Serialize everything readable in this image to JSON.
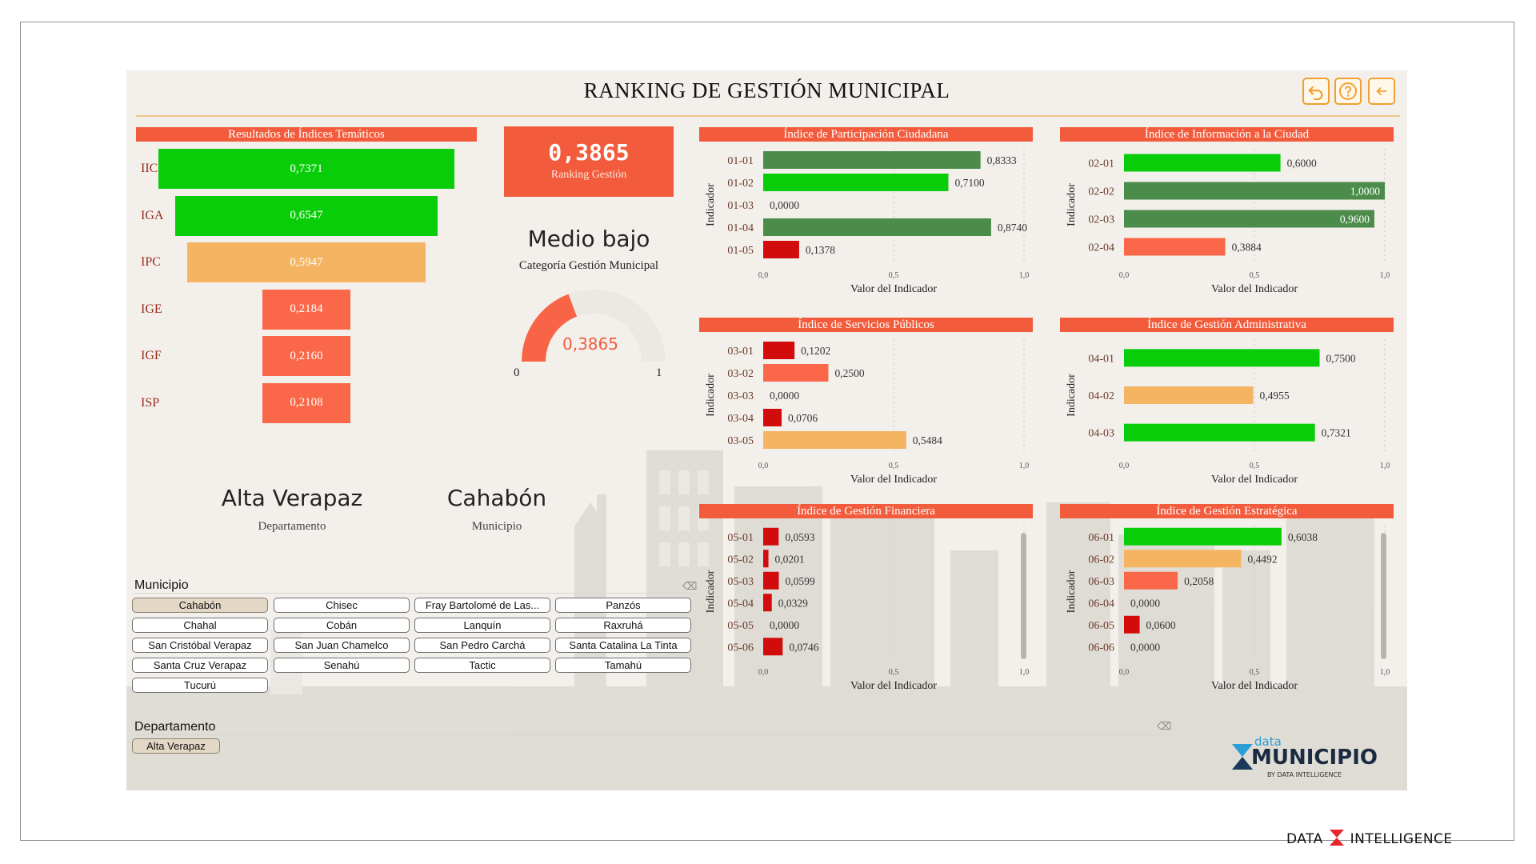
{
  "title": "RANKING DE GESTIÓN MUNICIPAL",
  "toolbar": {
    "reset_icon": "undo-icon",
    "help_icon": "help-icon",
    "back_icon": "back-arrow-icon"
  },
  "colors": {
    "dark_green": "#4c8c4a",
    "green": "#0acd0a",
    "amber": "#f4b462",
    "orange": "#fb6849",
    "red": "#d20c0c",
    "header": "#f25c3c"
  },
  "funnel": {
    "header": "Resultados de Índices Temáticos",
    "items": [
      {
        "label": "IIC",
        "value": 0.7371,
        "text": "0,7371",
        "color": "#0acd0a"
      },
      {
        "label": "IGA",
        "value": 0.6547,
        "text": "0,6547",
        "color": "#0acd0a"
      },
      {
        "label": "IPC",
        "value": 0.5947,
        "text": "0,5947",
        "color": "#f4b462"
      },
      {
        "label": "IGE",
        "value": 0.2184,
        "text": "0,2184",
        "color": "#fb6849"
      },
      {
        "label": "IGF",
        "value": 0.216,
        "text": "0,2160",
        "color": "#fb6849"
      },
      {
        "label": "ISP",
        "value": 0.2108,
        "text": "0,2108",
        "color": "#fb6849"
      }
    ]
  },
  "kpi": {
    "value": "0,3865",
    "label": "Ranking Gestión"
  },
  "category": {
    "title": "Medio bajo",
    "subtitle": "Categoría Gestión Municipal"
  },
  "gauge": {
    "value": 0.3865,
    "value_text": "0,3865",
    "min": "0",
    "max": "1"
  },
  "location": {
    "department": "Alta Verapaz",
    "department_label": "Departamento",
    "municipality": "Cahabón",
    "municipality_label": "Municipio"
  },
  "chart_data": [
    {
      "type": "bar",
      "title": "Índice de Participación Ciudadana",
      "xlabel": "Valor del Indicador",
      "ylabel": "Indicador",
      "xlim": [
        0,
        1
      ],
      "xticks": [
        "0,0",
        "0,5",
        "1,0"
      ],
      "categories": [
        "01-01",
        "01-02",
        "01-03",
        "01-04",
        "01-05"
      ],
      "values": [
        0.8333,
        0.71,
        0.0,
        0.874,
        0.1378
      ],
      "labels": [
        "0,8333",
        "0,7100",
        "0,0000",
        "0,8740",
        "0,1378"
      ],
      "colors": [
        "#4c8c4a",
        "#0acd0a",
        "#0acd0a",
        "#4c8c4a",
        "#d20c0c"
      ]
    },
    {
      "type": "bar",
      "title": "Índice de Información a la Ciudad",
      "xlabel": "Valor del Indicador",
      "ylabel": "Indicador",
      "xlim": [
        0,
        1
      ],
      "xticks": [
        "0,0",
        "0,5",
        "1,0"
      ],
      "categories": [
        "02-01",
        "02-02",
        "02-03",
        "02-04"
      ],
      "values": [
        0.6,
        1.0,
        0.96,
        0.3884
      ],
      "labels": [
        "0,6000",
        "1,0000",
        "0,9600",
        "0,3884"
      ],
      "colors": [
        "#0acd0a",
        "#4c8c4a",
        "#4c8c4a",
        "#fb6849"
      ]
    },
    {
      "type": "bar",
      "title": "Índice de Servicios Públicos",
      "xlabel": "Valor del Indicador",
      "ylabel": "Indicador",
      "xlim": [
        0,
        1
      ],
      "xticks": [
        "0,0",
        "0,5",
        "1,0"
      ],
      "categories": [
        "03-01",
        "03-02",
        "03-03",
        "03-04",
        "03-05"
      ],
      "values": [
        0.1202,
        0.25,
        0.0,
        0.0706,
        0.5484
      ],
      "labels": [
        "0,1202",
        "0,2500",
        "0,0000",
        "0,0706",
        "0,5484"
      ],
      "colors": [
        "#d20c0c",
        "#fb6849",
        "#d20c0c",
        "#d20c0c",
        "#f4b462"
      ]
    },
    {
      "type": "bar",
      "title": "Índice de Gestión Administrativa",
      "xlabel": "Valor del Indicador",
      "ylabel": "Indicador",
      "xlim": [
        0,
        1
      ],
      "xticks": [
        "0,0",
        "0,5",
        "1,0"
      ],
      "categories": [
        "04-01",
        "04-02",
        "04-03"
      ],
      "values": [
        0.75,
        0.4955,
        0.7321
      ],
      "labels": [
        "0,7500",
        "0,4955",
        "0,7321"
      ],
      "colors": [
        "#0acd0a",
        "#f4b462",
        "#0acd0a"
      ]
    },
    {
      "type": "bar",
      "title": "Índice de Gestión Financiera",
      "xlabel": "Valor del Indicador",
      "ylabel": "Indicador",
      "xlim": [
        0,
        1
      ],
      "xticks": [
        "0,0",
        "0,5",
        "1,0"
      ],
      "categories": [
        "05-01",
        "05-02",
        "05-03",
        "05-04",
        "05-05",
        "05-06"
      ],
      "values": [
        0.0593,
        0.0201,
        0.0599,
        0.0329,
        0.0,
        0.0746
      ],
      "labels": [
        "0,0593",
        "0,0201",
        "0,0599",
        "0,0329",
        "0,0000",
        "0,0746"
      ],
      "colors": [
        "#d20c0c",
        "#d20c0c",
        "#d20c0c",
        "#d20c0c",
        "#d20c0c",
        "#d20c0c"
      ]
    },
    {
      "type": "bar",
      "title": "Índice de Gestión Estratégica",
      "xlabel": "Valor del Indicador",
      "ylabel": "Indicador",
      "xlim": [
        0,
        1
      ],
      "xticks": [
        "0,0",
        "0,5",
        "1,0"
      ],
      "categories": [
        "06-01",
        "06-02",
        "06-03",
        "06-04",
        "06-05",
        "06-06"
      ],
      "values": [
        0.6038,
        0.4492,
        0.2058,
        0.0,
        0.06,
        0.0
      ],
      "labels": [
        "0,6038",
        "0,4492",
        "0,2058",
        "0,0000",
        "0,0600",
        "0,0000"
      ],
      "colors": [
        "#0acd0a",
        "#f4b462",
        "#fb6849",
        "#d20c0c",
        "#d20c0c",
        "#d20c0c"
      ]
    }
  ],
  "municipio_slicer": {
    "title": "Municipio",
    "selected": "Cahabón",
    "options": [
      "Cahabón",
      "Chisec",
      "Fray Bartolomé de Las...",
      "Panzós",
      "Chahal",
      "Cobán",
      "Lanquín",
      "Raxruhá",
      "San Cristóbal Verapaz",
      "San Juan Chamelco",
      "San Pedro Carchá",
      "Santa Catalina La Tinta",
      "Santa Cruz Verapaz",
      "Senahú",
      "Tactic",
      "Tamahú",
      "Tucurú"
    ]
  },
  "departamento_slicer": {
    "title": "Departamento",
    "selected": "Alta Verapaz",
    "options": [
      "Alta Verapaz"
    ]
  },
  "brand": {
    "top": "data",
    "main": "MUNICIPIO",
    "by": "BY DATA INTELLIGENCE"
  },
  "footer": {
    "left": "DATA",
    "right": "INTELLIGENCE"
  }
}
